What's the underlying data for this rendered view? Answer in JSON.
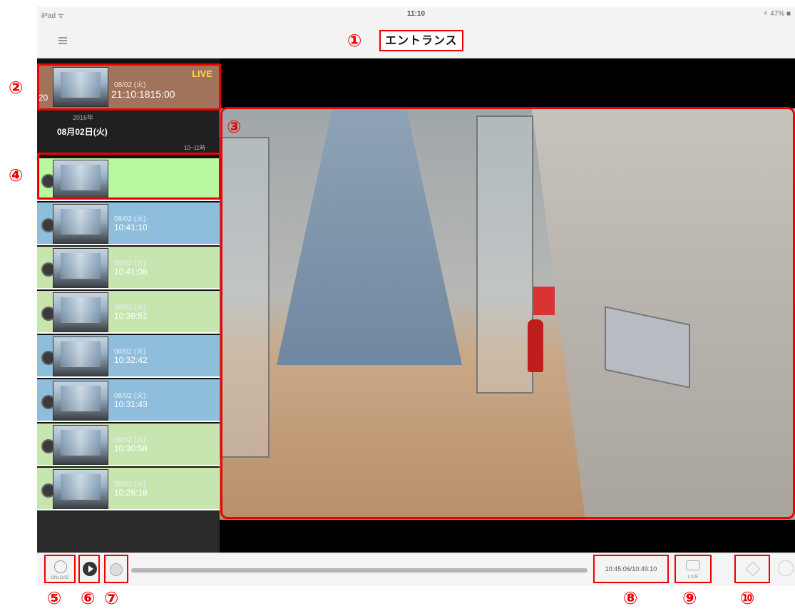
{
  "status_bar": {
    "carrier": "iPad ᯤ",
    "time": "11:10",
    "battery": "⚡ 47% ■"
  },
  "header": {
    "title": "エントランス"
  },
  "live_item": {
    "badge": "LIVE",
    "date": "08/02 (火)",
    "time": "21:10:1815:00",
    "year_prefix": "20"
  },
  "day_header": {
    "year": "2016年",
    "date": "08月02日(火)",
    "hour_range": "10~11時"
  },
  "clips": [
    {
      "date": "",
      "time": "",
      "color": "#b9f7a0",
      "state": "active"
    },
    {
      "date": "08/02 (火)",
      "time": "10:41:10",
      "color": "#8fbddc"
    },
    {
      "date": "08/02 (火)",
      "time": "10:41:06",
      "color": "#c7e5ae"
    },
    {
      "date": "08/02 (火)",
      "time": "10:36:51",
      "color": "#c7e5ae"
    },
    {
      "date": "08/02 (火)",
      "time": "10:32:42",
      "color": "#8fbddc"
    },
    {
      "date": "08/02 (火)",
      "time": "10:31:43",
      "color": "#8fbddc"
    },
    {
      "date": "08/02 (火)",
      "time": "10:30:58",
      "color": "#c7e5ae"
    },
    {
      "date": "08/02 (火)",
      "time": "10:26:18",
      "color": "#c7e5ae"
    }
  ],
  "controls": {
    "timer_label": "ONLOAD",
    "time_readout": "10:45:06/10:49:10",
    "live_label": "LIVE"
  },
  "markers": [
    "①",
    "②",
    "③",
    "④",
    "⑤",
    "⑥",
    "⑦",
    "⑧",
    "⑨",
    "⑩"
  ],
  "accent_color": "#ee0000"
}
